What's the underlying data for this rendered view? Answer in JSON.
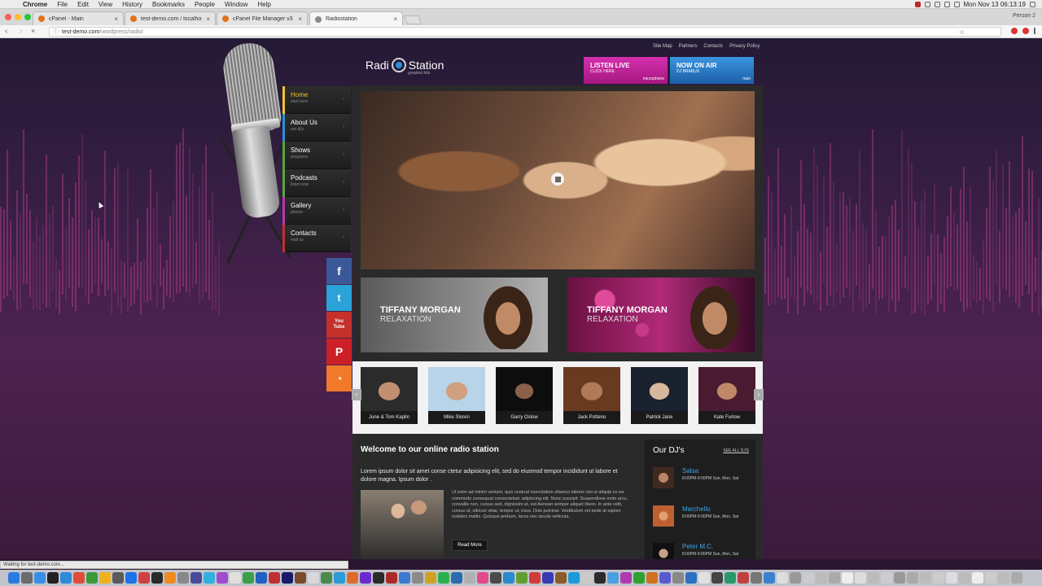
{
  "menubar": {
    "app": "Chrome",
    "items": [
      "File",
      "Edit",
      "View",
      "History",
      "Bookmarks",
      "People",
      "Window",
      "Help"
    ],
    "clock": "Mon Nov 13  06:13:19"
  },
  "browser": {
    "tabs": [
      {
        "title": "cPanel - Main",
        "color": "#e0731c"
      },
      {
        "title": "test-demo.com / localhost / d",
        "color": "#e0731c"
      },
      {
        "title": "cPanel File Manager v3",
        "color": "#e0731c"
      },
      {
        "title": "Radiostation",
        "color": "#8a8a8a"
      }
    ],
    "person": "Person 2",
    "url_host": "test-demo.com",
    "url_path": "/wordpress/radio/",
    "status": "Waiting for test-demo.com..."
  },
  "site": {
    "logo_a": "Radi",
    "logo_b": "Station",
    "logo_sub": "greatest hits",
    "toplinks": [
      "Site Map",
      "Partners",
      "Contacts",
      "Privacy Policy"
    ],
    "listen": {
      "title": "LISTEN LIVE",
      "sub": "CLICK HERE",
      "tag": "microphone"
    },
    "onair": {
      "title": "NOW ON AIR",
      "sub": "DJ BRABUS",
      "tag": "man"
    },
    "nav": [
      {
        "label": "Home",
        "sub": "start here",
        "color": "#f3c32d"
      },
      {
        "label": "About Us",
        "sub": "our dj's",
        "color": "#2a8fd8"
      },
      {
        "label": "Shows",
        "sub": "programs",
        "color": "#5aa43a"
      },
      {
        "label": "Podcasts",
        "sub": "listen now",
        "color": "#5aa43a"
      },
      {
        "label": "Gallery",
        "sub": "photos",
        "color": "#b23aa8"
      },
      {
        "label": "Contacts",
        "sub": "mail us",
        "color": "#c03030"
      }
    ],
    "social": [
      {
        "glyph": "f",
        "color": "#3b5998"
      },
      {
        "glyph": "t",
        "color": "#29a3d8"
      },
      {
        "glyph": "You Tube",
        "color": "#c4302b"
      },
      {
        "glyph": "P",
        "color": "#cb2027"
      },
      {
        "glyph": "◔",
        "color": "#f07a2a"
      }
    ],
    "promos": [
      {
        "name": "TIFFANY MORGAN",
        "type": "RELAXATION"
      },
      {
        "name": "TIFFANY MORGAN",
        "type": "RELAXATION"
      }
    ],
    "djs": [
      "June & Tom Kaplin",
      "Mike Sloren",
      "Garry Oslow",
      "Jack Potteno",
      "Patrick Jane",
      "Kate Furlow"
    ],
    "welcome": {
      "title": "Welcome to our online radio station",
      "lead": "Lorem ipsum dolor sit amet conse ctetur adipisicing elit, sed do eiusmod tempor incididunt ut labore et dolore magna. Ipsum dolor .",
      "body": "Ut enim ad minim veniam, quis nostrud exercitation ullamco laboris nisi ut aliquip ex ea commodo consequat consectetuer adipiscing elit. Nunc suscipit. Suspendisse enim arcu, convallis non, cursus sed, dignissim et, est Aenean semper aliquet libero. In ante velit, cursus ut, ultrices vitae, tempor ut, risus. Duis pulvinar. Vestibulum vel pede at sapien sodales mattis. Quisque pretium, lacus nec iaculis vehicula.",
      "more": "Read More"
    },
    "ourdjs": {
      "title": "Our DJ's",
      "seeall": "SEE ALL DJ'S",
      "items": [
        {
          "name": "Salsa",
          "time": "8:00PM-9:00PM Sun, Mon, Sat"
        },
        {
          "name": "Marchello",
          "time": "8:00PM-9:00PM Sun, Mon, Sat"
        },
        {
          "name": "Peter M.C.",
          "time": "8:00PM-9:00PM Sun, Mon, Sat"
        }
      ]
    }
  }
}
